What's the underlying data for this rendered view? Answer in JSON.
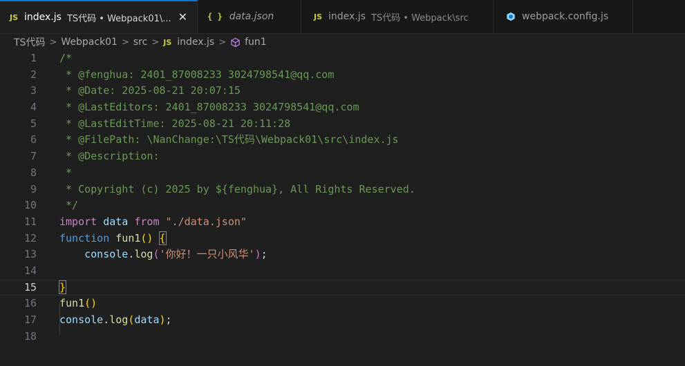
{
  "tabs": [
    {
      "icon": "JS",
      "name": "index.js",
      "desc": "TS代码 • Webpack01\\...",
      "close": "✕",
      "active": true
    },
    {
      "icon": "{ }",
      "name": "data.json",
      "desc": "",
      "active": false
    },
    {
      "icon": "JS",
      "name": "index.js",
      "desc": "TS代码 • Webpack\\src",
      "active": false
    },
    {
      "icon": "webpack-cube-icon",
      "name": "webpack.config.js",
      "desc": "",
      "active": false
    }
  ],
  "breadcrumb": {
    "items": [
      "TS代码",
      "Webpack01",
      "src"
    ],
    "file_icon": "JS",
    "file": "index.js",
    "symbol": "fun1"
  },
  "editor": {
    "current_line": 15,
    "lines": [
      {
        "n": "1",
        "tokens": [
          {
            "t": "/*",
            "c": "c-comment"
          }
        ]
      },
      {
        "n": "2",
        "tokens": [
          {
            "t": " * @fenghua: 2401_87008233 3024798541@qq.com",
            "c": "c-comment"
          }
        ]
      },
      {
        "n": "3",
        "tokens": [
          {
            "t": " * @Date: 2025-08-21 20:07:15",
            "c": "c-comment"
          }
        ]
      },
      {
        "n": "4",
        "tokens": [
          {
            "t": " * @LastEditors: 2401_87008233 3024798541@qq.com",
            "c": "c-comment"
          }
        ]
      },
      {
        "n": "5",
        "tokens": [
          {
            "t": " * @LastEditTime: 2025-08-21 20:11:28",
            "c": "c-comment"
          }
        ]
      },
      {
        "n": "6",
        "tokens": [
          {
            "t": " * @FilePath: \\NanChange:\\TS代码\\Webpack01\\src\\index.js",
            "c": "c-comment"
          }
        ]
      },
      {
        "n": "7",
        "tokens": [
          {
            "t": " * @Description:",
            "c": "c-comment"
          }
        ]
      },
      {
        "n": "8",
        "tokens": [
          {
            "t": " *",
            "c": "c-comment"
          }
        ]
      },
      {
        "n": "9",
        "tokens": [
          {
            "t": " * Copyright (c) 2025 by ${fenghua}, All Rights Reserved.",
            "c": "c-comment"
          }
        ]
      },
      {
        "n": "10",
        "tokens": [
          {
            "t": " */",
            "c": "c-comment"
          }
        ]
      },
      {
        "n": "11",
        "tokens": [
          {
            "t": "import",
            "c": "c-kw"
          },
          {
            "t": " ",
            "c": "c-plain"
          },
          {
            "t": "data",
            "c": "c-var"
          },
          {
            "t": " ",
            "c": "c-plain"
          },
          {
            "t": "from",
            "c": "c-kw"
          },
          {
            "t": " ",
            "c": "c-plain"
          },
          {
            "t": "\"./data.json\"",
            "c": "c-str"
          }
        ]
      },
      {
        "n": "12",
        "tokens": [
          {
            "t": "function",
            "c": "c-fnkw"
          },
          {
            "t": " ",
            "c": "c-plain"
          },
          {
            "t": "fun1",
            "c": "c-fn"
          },
          {
            "t": "()",
            "c": "c-brace"
          },
          {
            "t": " ",
            "c": "c-plain"
          },
          {
            "t": "{",
            "c": "c-brace-match"
          }
        ]
      },
      {
        "n": "13",
        "tokens": [
          {
            "t": "    ",
            "c": "c-plain"
          },
          {
            "t": "console",
            "c": "c-var"
          },
          {
            "t": ".",
            "c": "c-plain"
          },
          {
            "t": "log",
            "c": "c-fn"
          },
          {
            "t": "(",
            "c": "c-paren"
          },
          {
            "t": "'你好！一只小风华'",
            "c": "c-str"
          },
          {
            "t": ")",
            "c": "c-paren"
          },
          {
            "t": ";",
            "c": "c-plain"
          }
        ]
      },
      {
        "n": "14",
        "tokens": []
      },
      {
        "n": "15",
        "tokens": [
          {
            "t": "}",
            "c": "c-brace-match"
          }
        ]
      },
      {
        "n": "16",
        "tokens": [
          {
            "t": "fun1",
            "c": "c-fn"
          },
          {
            "t": "()",
            "c": "c-brace"
          }
        ]
      },
      {
        "n": "17",
        "tokens": [
          {
            "t": "console",
            "c": "c-var"
          },
          {
            "t": ".",
            "c": "c-plain"
          },
          {
            "t": "log",
            "c": "c-fn"
          },
          {
            "t": "(",
            "c": "c-brace"
          },
          {
            "t": "data",
            "c": "c-var"
          },
          {
            "t": ")",
            "c": "c-brace"
          },
          {
            "t": ";",
            "c": "c-plain"
          }
        ]
      },
      {
        "n": "18",
        "tokens": []
      }
    ]
  },
  "colors": {
    "editor_bg": "#1f1f1f",
    "tab_active_accent": "#0078d4",
    "comment": "#6a9955",
    "keyword": "#c586c0",
    "string": "#ce9178"
  }
}
